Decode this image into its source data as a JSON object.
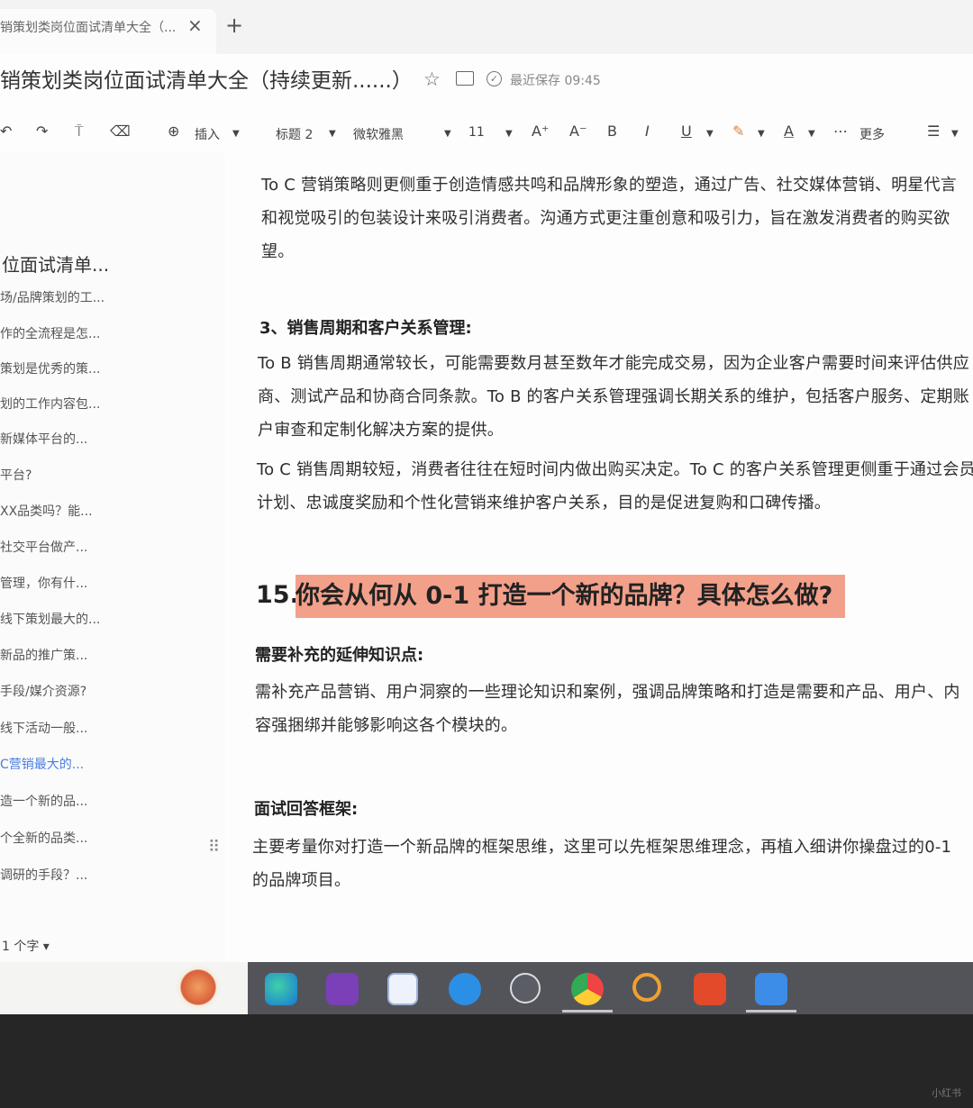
{
  "tab": {
    "title": "销策划类岗位面试清单大全（...",
    "close": "×",
    "add": "+"
  },
  "header": {
    "title": "销策划类岗位面试清单大全（持续更新......）",
    "save_status": "最近保存 09:45"
  },
  "toolbar": {
    "undo": "↶",
    "redo": "↷",
    "format_painter": "⍑",
    "clear": "⌫",
    "insert": "插入",
    "heading": "标题 2",
    "font": "微软雅黑",
    "size": "11",
    "grow": "A⁺",
    "shrink": "A⁻",
    "bold": "B",
    "italic": "I",
    "underline": "U",
    "highlight": "✎",
    "font_color": "A",
    "more": "更多",
    "list": "☰"
  },
  "sidebar": {
    "outline_title": "位面试清单...",
    "items": [
      "场/品牌策划的工...",
      "作的全流程是怎...",
      "策划是优秀的策...",
      "划的工作内容包...",
      "新媒体平台的...",
      "平台?",
      "XX品类吗？能...",
      "社交平台做产...",
      "管理，你有什...",
      "线下策划最大的...",
      "新品的推广策...",
      "手段/媒介资源?",
      "线下活动一般...",
      "C营销最大的...",
      "造一个新的品...",
      "个全新的品类...",
      "调研的手段？..."
    ],
    "active_index": 13,
    "word_count": "1 个字 ▾"
  },
  "content": {
    "p1": "To C 营销策略则更侧重于创造情感共鸣和品牌形象的塑造，通过广告、社交媒体营销、明星代言和视觉吸引的包装设计来吸引消费者。沟通方式更注重创意和吸引力，旨在激发消费者的购买欲望。",
    "h3": "3、销售周期和客户关系管理:",
    "p2": "To B 销售周期通常较长，可能需要数月甚至数年才能完成交易，因为企业客户需要时间来评估供应商、测试产品和协商合同条款。To B 的客户关系管理强调长期关系的维护，包括客户服务、定期账户审查和定制化解决方案的提供。",
    "p3": "To C 销售周期较短，消费者往往在短时间内做出购买决定。To C 的客户关系管理更侧重于通过会员计划、忠诚度奖励和个性化营销来维护客户关系，目的是促进复购和口碑传播。",
    "h15_num": "15.",
    "h15_text": "你会从何从 0-1 打造一个新的品牌？具体怎么做?",
    "sub1": "需要补充的延伸知识点:",
    "p4": "需补充产品营销、用户洞察的一些理论知识和案例，强调品牌策略和打造是需要和产品、用户、内容强捆绑并能够影响这各个模块的。",
    "sub2": "面试回答框架:",
    "p5": "主要考量你对打造一个新品牌的框架思维，这里可以先框架思维理念，再植入细讲你操盘过的0-1 的品牌项目。"
  },
  "taskbar": {
    "icons": [
      "edge-icon",
      "onenote-icon",
      "files-icon",
      "sogou-icon",
      "dots-app-icon",
      "chrome-icon",
      "search-app-icon",
      "wps-icon",
      "feishu-icon"
    ],
    "colors": {
      "bar": "#53545a",
      "highlight": "#f3a08a",
      "active_outline": "#4a7de0"
    }
  },
  "watermark": "小红书"
}
